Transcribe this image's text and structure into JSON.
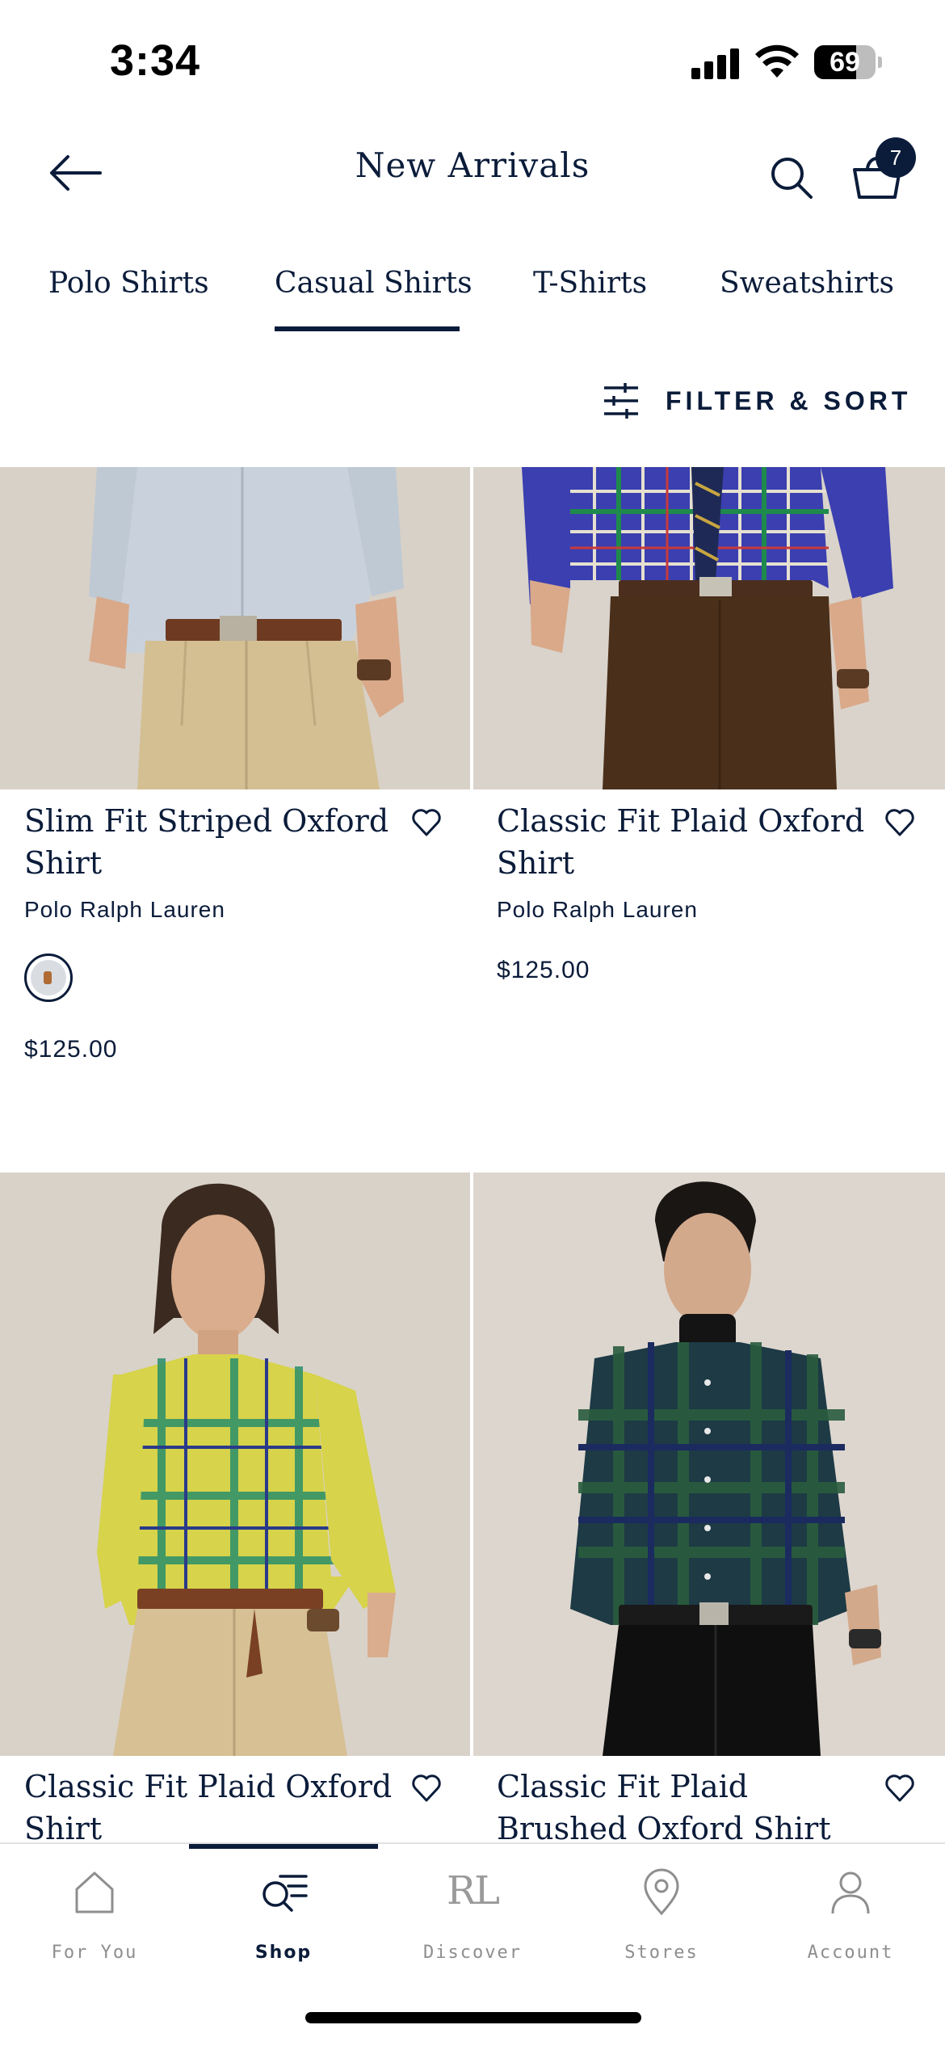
{
  "status_bar": {
    "time": "3:34",
    "battery": "69",
    "battery_level": 0.69
  },
  "header": {
    "title": "New Arrivals",
    "cart_count": "7"
  },
  "tabs": [
    {
      "label": "Polo Shirts"
    },
    {
      "label": "Casual Shirts",
      "active": true
    },
    {
      "label": "T-Shirts"
    },
    {
      "label": "Sweatshirts"
    }
  ],
  "filter": {
    "label": "FILTER & SORT"
  },
  "products": [
    {
      "name": "Slim Fit Striped Oxford Shirt",
      "brand": "Polo Ralph Lauren",
      "price": "$125.00"
    },
    {
      "name": "Classic Fit Plaid Oxford Shirt",
      "brand": "Polo Ralph Lauren",
      "price": "$125.00"
    },
    {
      "name": "Classic Fit Plaid Oxford Shirt"
    },
    {
      "name": "Classic Fit Plaid Brushed Oxford Shirt"
    }
  ],
  "bottom_nav": [
    {
      "label": "For You",
      "icon": "home-icon"
    },
    {
      "label": "Shop",
      "icon": "shop-icon",
      "active": true
    },
    {
      "label": "Discover",
      "icon": "rl-logo-icon",
      "logo_text": "RL"
    },
    {
      "label": "Stores",
      "icon": "location-pin-icon"
    },
    {
      "label": "Account",
      "icon": "account-icon"
    }
  ],
  "colors": {
    "brand_navy": "#0b1c3a",
    "inactive_gray": "#8e8e8e"
  }
}
